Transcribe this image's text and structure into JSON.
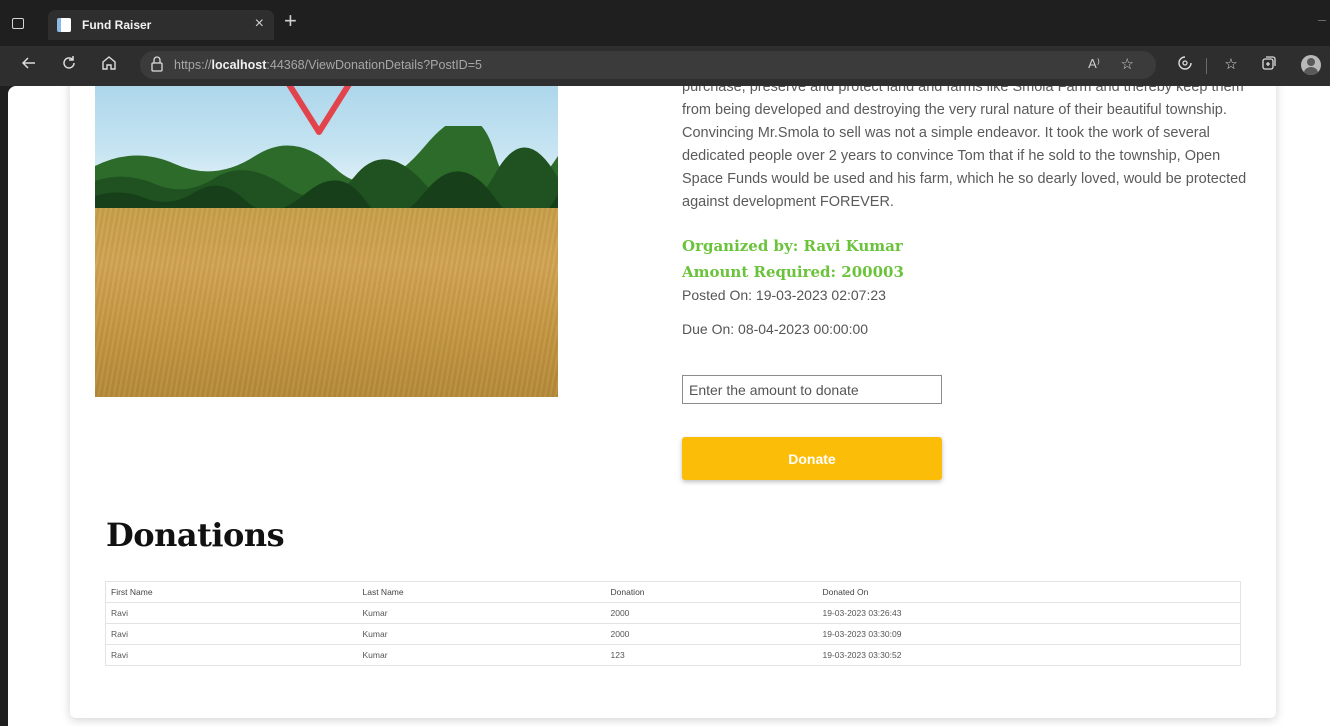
{
  "browser": {
    "tab_title": "Fund Raiser",
    "tab_close": "×",
    "new_tab": "+",
    "url_prefix": "https://",
    "url_host": "localhost",
    "url_rest": ":44368/ViewDonationDetails?PostID=5",
    "read_aloud": "A⁾"
  },
  "post": {
    "description": "purchase, preserve and protect land and farms like Smola Farm and thereby keep them from being developed and destroying the very rural nature of their beautiful township. Convincing Mr.Smola to sell was not a simple endeavor. It took the work of several dedicated people over 2 years to convince Tom that if he sold to the township, Open Space Funds would be used and his farm, which he so dearly loved, would be protected against development FOREVER.",
    "organized_by": "Organized by: Ravi Kumar",
    "amount_required": "Amount Required: 200003",
    "posted_on": "Posted On: 19-03-2023 02:07:23",
    "due_on": "Due On: 08-04-2023 00:00:00"
  },
  "donate_form": {
    "amount_placeholder": "Enter the amount to donate",
    "amount_value": "",
    "button_label": "Donate"
  },
  "donations": {
    "title": "Donations",
    "columns": [
      "First Name",
      "Last Name",
      "Donation",
      "Donated On"
    ],
    "rows": [
      [
        "Ravi",
        "Kumar",
        "2000",
        "19-03-2023 03:26:43"
      ],
      [
        "Ravi",
        "Kumar",
        "2000",
        "19-03-2023 03:30:09"
      ],
      [
        "Ravi",
        "Kumar",
        "123",
        "19-03-2023 03:30:52"
      ]
    ]
  },
  "colors": {
    "accent_green": "#6ac33a",
    "donate_yellow": "#fbbd08"
  },
  "icons": [
    "window-icon",
    "page-icon",
    "back-icon",
    "refresh-icon",
    "home-icon",
    "lock-icon",
    "favorite-add-icon",
    "extensions-icon",
    "favorites-icon",
    "collections-icon",
    "profile-icon"
  ]
}
